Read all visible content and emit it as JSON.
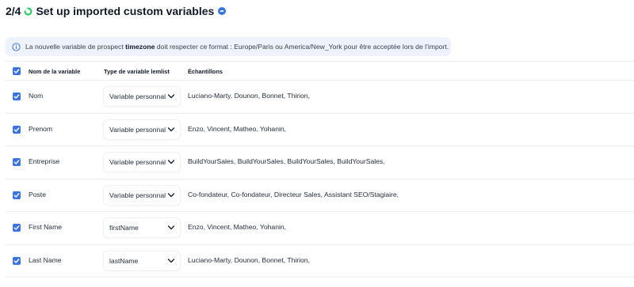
{
  "header": {
    "step": "2/4",
    "title": "Set up imported custom variables"
  },
  "banner": {
    "before": "La nouvelle variable de prospect ",
    "keyword": "timezone",
    "after": " doit respecter ce format : Europe/Paris ou America/New_York pour être acceptée lors de l’import."
  },
  "table": {
    "headers": {
      "name": "Nom de la variable",
      "type": "Type de variable lemlist",
      "samples": "Échantillons"
    },
    "rows": [
      {
        "name": "Nom",
        "type": "Variable personnal",
        "samples": "Luciano-Marty, Dounon, Bonnet, Thirion,"
      },
      {
        "name": "Prenom",
        "type": "Variable personnal",
        "samples": "Enzo, Vincent, Matheo, Yohanin,"
      },
      {
        "name": "Entreprise",
        "type": "Variable personnal",
        "samples": "BuildYourSales, BuildYourSales, BuildYourSales, BuildYourSales,"
      },
      {
        "name": "Poste",
        "type": "Variable personnal",
        "samples": "Co-fondateur, Co-fondateur, Directeur Sales, Assistant SEO/Stagiaire,"
      },
      {
        "name": "First Name",
        "type": "firstName",
        "samples": "Enzo, Vincent, Matheo, Yohanin,"
      },
      {
        "name": "Last Name",
        "type": "lastName",
        "samples": "Luciano-Marty, Dounon, Bonnet, Thirion,"
      }
    ]
  },
  "colors": {
    "accent": "#3b73e0",
    "progress": "#22c55e",
    "banner_bg": "#eef3fb"
  },
  "icons": {
    "progress": "progress-ring-icon",
    "help": "help-dot-icon",
    "info": "info-icon",
    "checkbox": "check-icon",
    "dropdown": "chevron-down-icon"
  }
}
